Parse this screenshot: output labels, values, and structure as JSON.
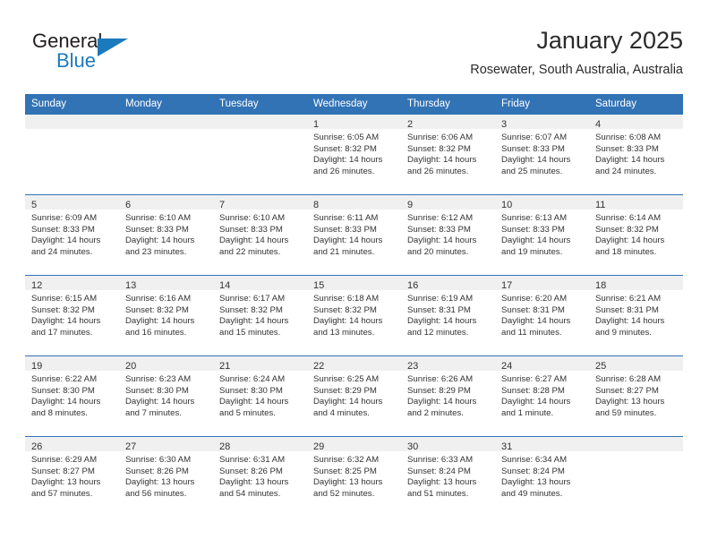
{
  "brand": {
    "name_part1": "General",
    "name_part2": "Blue",
    "accent_color": "#1b7abd",
    "logo_icon": "triangle-flag-icon"
  },
  "header": {
    "title": "January 2025",
    "subtitle": "Rosewater, South Australia, Australia",
    "header_bg_color": "#3273b6",
    "daynum_band_color": "#f0f0f0"
  },
  "weekday_headers": [
    "Sunday",
    "Monday",
    "Tuesday",
    "Wednesday",
    "Thursday",
    "Friday",
    "Saturday"
  ],
  "weeks": [
    [
      {
        "day": "",
        "sunrise": "",
        "sunset": "",
        "daylight_line1": "",
        "daylight_line2": ""
      },
      {
        "day": "",
        "sunrise": "",
        "sunset": "",
        "daylight_line1": "",
        "daylight_line2": ""
      },
      {
        "day": "",
        "sunrise": "",
        "sunset": "",
        "daylight_line1": "",
        "daylight_line2": ""
      },
      {
        "day": "1",
        "sunrise": "Sunrise: 6:05 AM",
        "sunset": "Sunset: 8:32 PM",
        "daylight_line1": "Daylight: 14 hours",
        "daylight_line2": "and 26 minutes."
      },
      {
        "day": "2",
        "sunrise": "Sunrise: 6:06 AM",
        "sunset": "Sunset: 8:32 PM",
        "daylight_line1": "Daylight: 14 hours",
        "daylight_line2": "and 26 minutes."
      },
      {
        "day": "3",
        "sunrise": "Sunrise: 6:07 AM",
        "sunset": "Sunset: 8:33 PM",
        "daylight_line1": "Daylight: 14 hours",
        "daylight_line2": "and 25 minutes."
      },
      {
        "day": "4",
        "sunrise": "Sunrise: 6:08 AM",
        "sunset": "Sunset: 8:33 PM",
        "daylight_line1": "Daylight: 14 hours",
        "daylight_line2": "and 24 minutes."
      }
    ],
    [
      {
        "day": "5",
        "sunrise": "Sunrise: 6:09 AM",
        "sunset": "Sunset: 8:33 PM",
        "daylight_line1": "Daylight: 14 hours",
        "daylight_line2": "and 24 minutes."
      },
      {
        "day": "6",
        "sunrise": "Sunrise: 6:10 AM",
        "sunset": "Sunset: 8:33 PM",
        "daylight_line1": "Daylight: 14 hours",
        "daylight_line2": "and 23 minutes."
      },
      {
        "day": "7",
        "sunrise": "Sunrise: 6:10 AM",
        "sunset": "Sunset: 8:33 PM",
        "daylight_line1": "Daylight: 14 hours",
        "daylight_line2": "and 22 minutes."
      },
      {
        "day": "8",
        "sunrise": "Sunrise: 6:11 AM",
        "sunset": "Sunset: 8:33 PM",
        "daylight_line1": "Daylight: 14 hours",
        "daylight_line2": "and 21 minutes."
      },
      {
        "day": "9",
        "sunrise": "Sunrise: 6:12 AM",
        "sunset": "Sunset: 8:33 PM",
        "daylight_line1": "Daylight: 14 hours",
        "daylight_line2": "and 20 minutes."
      },
      {
        "day": "10",
        "sunrise": "Sunrise: 6:13 AM",
        "sunset": "Sunset: 8:33 PM",
        "daylight_line1": "Daylight: 14 hours",
        "daylight_line2": "and 19 minutes."
      },
      {
        "day": "11",
        "sunrise": "Sunrise: 6:14 AM",
        "sunset": "Sunset: 8:32 PM",
        "daylight_line1": "Daylight: 14 hours",
        "daylight_line2": "and 18 minutes."
      }
    ],
    [
      {
        "day": "12",
        "sunrise": "Sunrise: 6:15 AM",
        "sunset": "Sunset: 8:32 PM",
        "daylight_line1": "Daylight: 14 hours",
        "daylight_line2": "and 17 minutes."
      },
      {
        "day": "13",
        "sunrise": "Sunrise: 6:16 AM",
        "sunset": "Sunset: 8:32 PM",
        "daylight_line1": "Daylight: 14 hours",
        "daylight_line2": "and 16 minutes."
      },
      {
        "day": "14",
        "sunrise": "Sunrise: 6:17 AM",
        "sunset": "Sunset: 8:32 PM",
        "daylight_line1": "Daylight: 14 hours",
        "daylight_line2": "and 15 minutes."
      },
      {
        "day": "15",
        "sunrise": "Sunrise: 6:18 AM",
        "sunset": "Sunset: 8:32 PM",
        "daylight_line1": "Daylight: 14 hours",
        "daylight_line2": "and 13 minutes."
      },
      {
        "day": "16",
        "sunrise": "Sunrise: 6:19 AM",
        "sunset": "Sunset: 8:31 PM",
        "daylight_line1": "Daylight: 14 hours",
        "daylight_line2": "and 12 minutes."
      },
      {
        "day": "17",
        "sunrise": "Sunrise: 6:20 AM",
        "sunset": "Sunset: 8:31 PM",
        "daylight_line1": "Daylight: 14 hours",
        "daylight_line2": "and 11 minutes."
      },
      {
        "day": "18",
        "sunrise": "Sunrise: 6:21 AM",
        "sunset": "Sunset: 8:31 PM",
        "daylight_line1": "Daylight: 14 hours",
        "daylight_line2": "and 9 minutes."
      }
    ],
    [
      {
        "day": "19",
        "sunrise": "Sunrise: 6:22 AM",
        "sunset": "Sunset: 8:30 PM",
        "daylight_line1": "Daylight: 14 hours",
        "daylight_line2": "and 8 minutes."
      },
      {
        "day": "20",
        "sunrise": "Sunrise: 6:23 AM",
        "sunset": "Sunset: 8:30 PM",
        "daylight_line1": "Daylight: 14 hours",
        "daylight_line2": "and 7 minutes."
      },
      {
        "day": "21",
        "sunrise": "Sunrise: 6:24 AM",
        "sunset": "Sunset: 8:30 PM",
        "daylight_line1": "Daylight: 14 hours",
        "daylight_line2": "and 5 minutes."
      },
      {
        "day": "22",
        "sunrise": "Sunrise: 6:25 AM",
        "sunset": "Sunset: 8:29 PM",
        "daylight_line1": "Daylight: 14 hours",
        "daylight_line2": "and 4 minutes."
      },
      {
        "day": "23",
        "sunrise": "Sunrise: 6:26 AM",
        "sunset": "Sunset: 8:29 PM",
        "daylight_line1": "Daylight: 14 hours",
        "daylight_line2": "and 2 minutes."
      },
      {
        "day": "24",
        "sunrise": "Sunrise: 6:27 AM",
        "sunset": "Sunset: 8:28 PM",
        "daylight_line1": "Daylight: 14 hours",
        "daylight_line2": "and 1 minute."
      },
      {
        "day": "25",
        "sunrise": "Sunrise: 6:28 AM",
        "sunset": "Sunset: 8:27 PM",
        "daylight_line1": "Daylight: 13 hours",
        "daylight_line2": "and 59 minutes."
      }
    ],
    [
      {
        "day": "26",
        "sunrise": "Sunrise: 6:29 AM",
        "sunset": "Sunset: 8:27 PM",
        "daylight_line1": "Daylight: 13 hours",
        "daylight_line2": "and 57 minutes."
      },
      {
        "day": "27",
        "sunrise": "Sunrise: 6:30 AM",
        "sunset": "Sunset: 8:26 PM",
        "daylight_line1": "Daylight: 13 hours",
        "daylight_line2": "and 56 minutes."
      },
      {
        "day": "28",
        "sunrise": "Sunrise: 6:31 AM",
        "sunset": "Sunset: 8:26 PM",
        "daylight_line1": "Daylight: 13 hours",
        "daylight_line2": "and 54 minutes."
      },
      {
        "day": "29",
        "sunrise": "Sunrise: 6:32 AM",
        "sunset": "Sunset: 8:25 PM",
        "daylight_line1": "Daylight: 13 hours",
        "daylight_line2": "and 52 minutes."
      },
      {
        "day": "30",
        "sunrise": "Sunrise: 6:33 AM",
        "sunset": "Sunset: 8:24 PM",
        "daylight_line1": "Daylight: 13 hours",
        "daylight_line2": "and 51 minutes."
      },
      {
        "day": "31",
        "sunrise": "Sunrise: 6:34 AM",
        "sunset": "Sunset: 8:24 PM",
        "daylight_line1": "Daylight: 13 hours",
        "daylight_line2": "and 49 minutes."
      },
      {
        "day": "",
        "sunrise": "",
        "sunset": "",
        "daylight_line1": "",
        "daylight_line2": ""
      }
    ]
  ]
}
